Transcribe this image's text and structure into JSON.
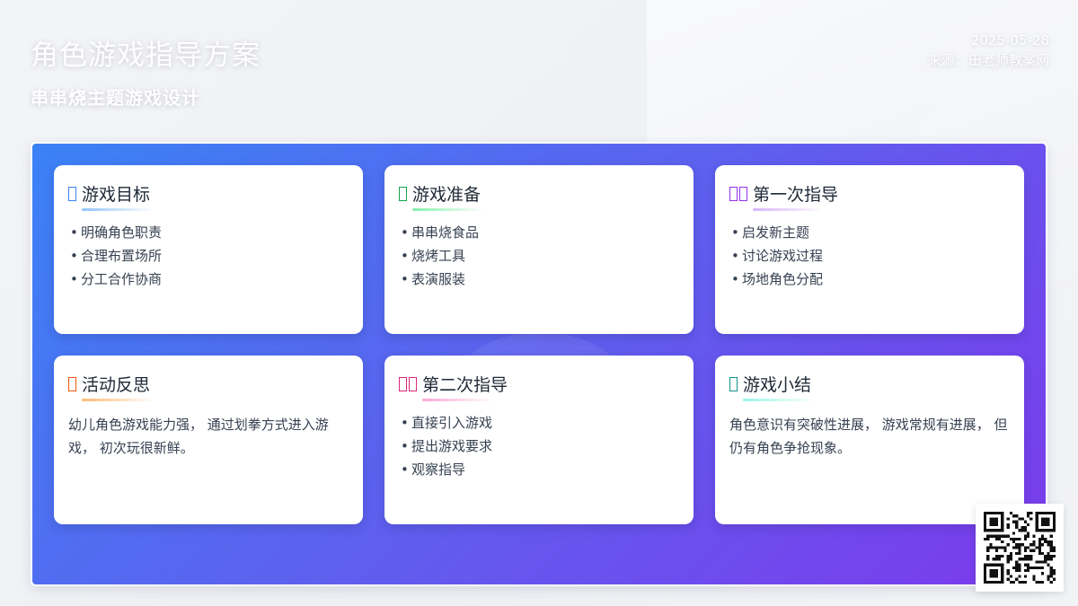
{
  "header": {
    "title": "角色游戏指导方案",
    "subtitle": "串串烧主题游戏设计",
    "date": "2025-05-28",
    "source": "来源：田老师教案网"
  },
  "colors": {
    "panel_start": "#3b82f6",
    "panel_end": "#7c3aed"
  },
  "cards": [
    {
      "title": "游戏目标",
      "icon": "target-icon",
      "accent": "#3b82f6",
      "underline": "#93c5fd",
      "items": [
        "明确角色职责",
        "合理布置场所",
        "分工合作协商"
      ]
    },
    {
      "title": "游戏准备",
      "icon": "box-icon",
      "accent": "#16a34a",
      "underline": "#86efac",
      "items": [
        "串串烧食品",
        "烧烤工具",
        "表演服装"
      ]
    },
    {
      "title": "第一次指导",
      "icon": "teacher-icon",
      "accent": "#9333ea",
      "underline": "#d8b4fe",
      "items": [
        "启发新主题",
        "讨论游戏过程",
        "场地角色分配"
      ]
    },
    {
      "title": "活动反思",
      "icon": "bulb-icon",
      "accent": "#ea580c",
      "underline": "#fdba74",
      "text": "幼儿角色游戏能力强， 通过划拳方式进入游戏， 初次玩很新鲜。"
    },
    {
      "title": "第二次指导",
      "icon": "teacher-icon",
      "accent": "#db2777",
      "underline": "#f9a8d4",
      "items": [
        "直接引入游戏",
        "提出游戏要求",
        "观察指导"
      ]
    },
    {
      "title": "游戏小结",
      "icon": "check-icon",
      "accent": "#0d9488",
      "underline": "#99f6e4",
      "text": "角色意识有突破性进展， 游戏常规有进展， 但仍有角色争抢现象。"
    }
  ],
  "qr": {
    "icon": "qr-code-icon"
  }
}
